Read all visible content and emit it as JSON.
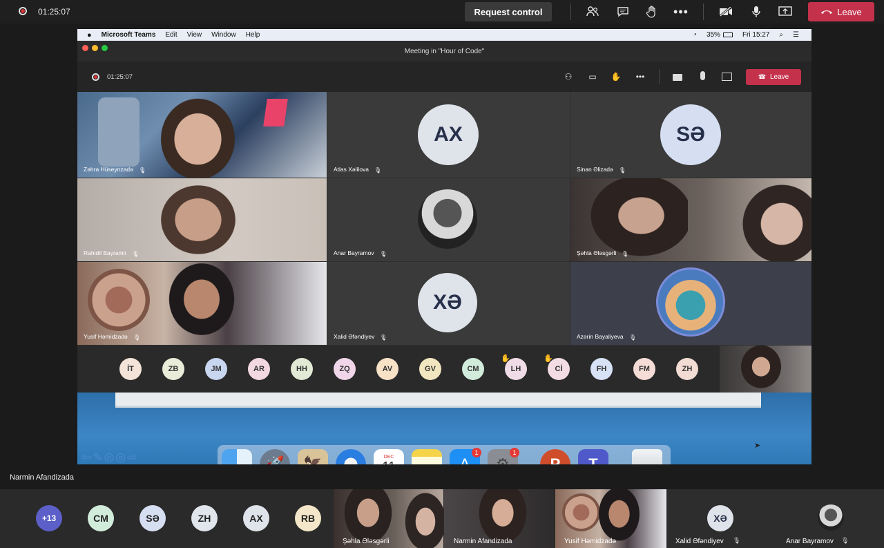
{
  "outer_toolbar": {
    "timer": "01:25:07",
    "request_control_label": "Request control",
    "leave_label": "Leave"
  },
  "mac_menu": {
    "app_name": "Microsoft Teams",
    "items": [
      "Edit",
      "View",
      "Window",
      "Help"
    ],
    "battery": "35%",
    "clock": "Fri 15:27"
  },
  "window_title": "Meeting in \"Hour of Code\"",
  "inner_toolbar": {
    "timer": "01:25:07",
    "leave_label": "Leave"
  },
  "grid_tiles": [
    {
      "name": "Zəhra Hüseynzadə",
      "kind": "video"
    },
    {
      "name": "Atlas Xəlilova",
      "kind": "avatar",
      "initials": "AX"
    },
    {
      "name": "Sinan Əlizadə",
      "kind": "avatar",
      "initials": "SƏ"
    },
    {
      "name": "Rahidil Bayramlı",
      "kind": "video"
    },
    {
      "name": "Anar Bayramov",
      "kind": "photo"
    },
    {
      "name": "Şəhla Ələsgərli",
      "kind": "video"
    },
    {
      "name": "Yusif Həmidzadə",
      "kind": "video"
    },
    {
      "name": "Xalid Əfəndiyev",
      "kind": "avatar",
      "initials": "XƏ"
    },
    {
      "name": "Azərin Bayaliyeva",
      "kind": "photo"
    }
  ],
  "strip_avatars": [
    {
      "initials": "İT",
      "color": "#f3e3d8",
      "hand": false
    },
    {
      "initials": "ZB",
      "color": "#e8ecd8",
      "hand": false
    },
    {
      "initials": "JM",
      "color": "#c8d6f0",
      "hand": false
    },
    {
      "initials": "AR",
      "color": "#f2d8e0",
      "hand": false
    },
    {
      "initials": "HH",
      "color": "#e2ead6",
      "hand": false
    },
    {
      "initials": "ZQ",
      "color": "#f0d6e8",
      "hand": false
    },
    {
      "initials": "AV",
      "color": "#f7e2c8",
      "hand": false
    },
    {
      "initials": "GV",
      "color": "#f2e6c0",
      "hand": false
    },
    {
      "initials": "CM",
      "color": "#d2ecdc",
      "hand": false
    },
    {
      "initials": "LH",
      "color": "#f0dce6",
      "hand": true
    },
    {
      "initials": "Cİ",
      "color": "#f3dce4",
      "hand": true
    },
    {
      "initials": "FH",
      "color": "#d8e2f6",
      "hand": false
    },
    {
      "initials": "FM",
      "color": "#f6dcd6",
      "hand": false
    },
    {
      "initials": "ZH",
      "color": "#f2dcd4",
      "hand": false
    }
  ],
  "dock": {
    "calendar_month": "DEC",
    "calendar_day": "11",
    "app_store_badge": "1",
    "settings_badge": "1"
  },
  "pinned_name": "Narmin Afandizada",
  "bottom_bar": {
    "overflow_count": "+13",
    "avatars": [
      {
        "initials": "CM",
        "color": "#d2ecdc"
      },
      {
        "initials": "SƏ",
        "color": "#d6def2"
      },
      {
        "initials": "ZH",
        "color": "#e0e6ec"
      },
      {
        "initials": "AX",
        "color": "#dfe4ea"
      },
      {
        "initials": "RB",
        "color": "#f4e6c8"
      }
    ],
    "video_tiles": [
      {
        "name": "Şəhla Ələsgərli"
      },
      {
        "name": "Narmin Afandizada"
      },
      {
        "name": "Yusif Həmidzadə"
      }
    ],
    "xalid": {
      "initials": "XƏ",
      "name": "Xalid Əfəndiyev"
    },
    "anar": {
      "name": "Anar Bayramov"
    }
  }
}
